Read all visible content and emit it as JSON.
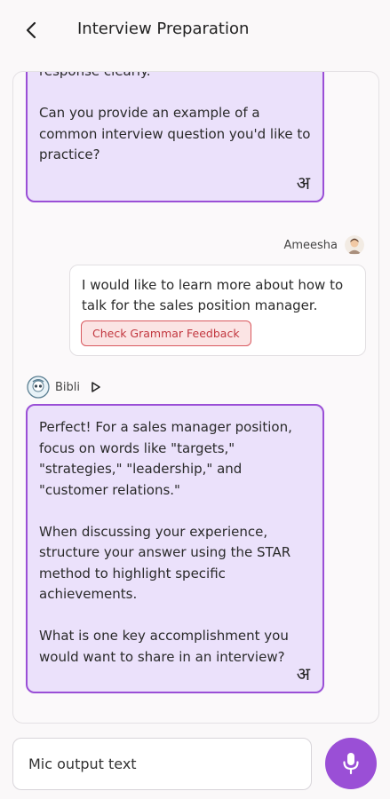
{
  "header": {
    "title": "Interview Preparation",
    "back_icon": "back-arrow-icon"
  },
  "messages": {
    "bot_message_1": {
      "paragraphs": [
        "response clearly.",
        "Can you provide an example of a common interview question you'd like to practice?"
      ],
      "translate_glyph": "अ"
    },
    "user_message": {
      "sender": "Ameesha",
      "text": "I would like to learn more about how to talk for the sales position manager.",
      "grammar_button": "Check Grammar Feedback"
    },
    "bot_message_2": {
      "sender": "Bibli",
      "paragraphs": [
        "Perfect! For a sales manager position, focus on words like \"targets,\" \"strategies,\" \"leadership,\" and \"customer relations.\"",
        "When discussing your experience, structure your answer using the STAR method to highlight specific achievements.",
        "What is one key accomplishment you would want to share in an interview?"
      ],
      "translate_glyph": "अ"
    }
  },
  "composer": {
    "input_value": "Mic output text",
    "mic_icon": "microphone-icon"
  },
  "colors": {
    "accent": "#9a4fd6",
    "bot_bubble_bg": "#ebe1fb",
    "grammar_bg": "#fbe4e4",
    "grammar_text": "#c2373f"
  }
}
